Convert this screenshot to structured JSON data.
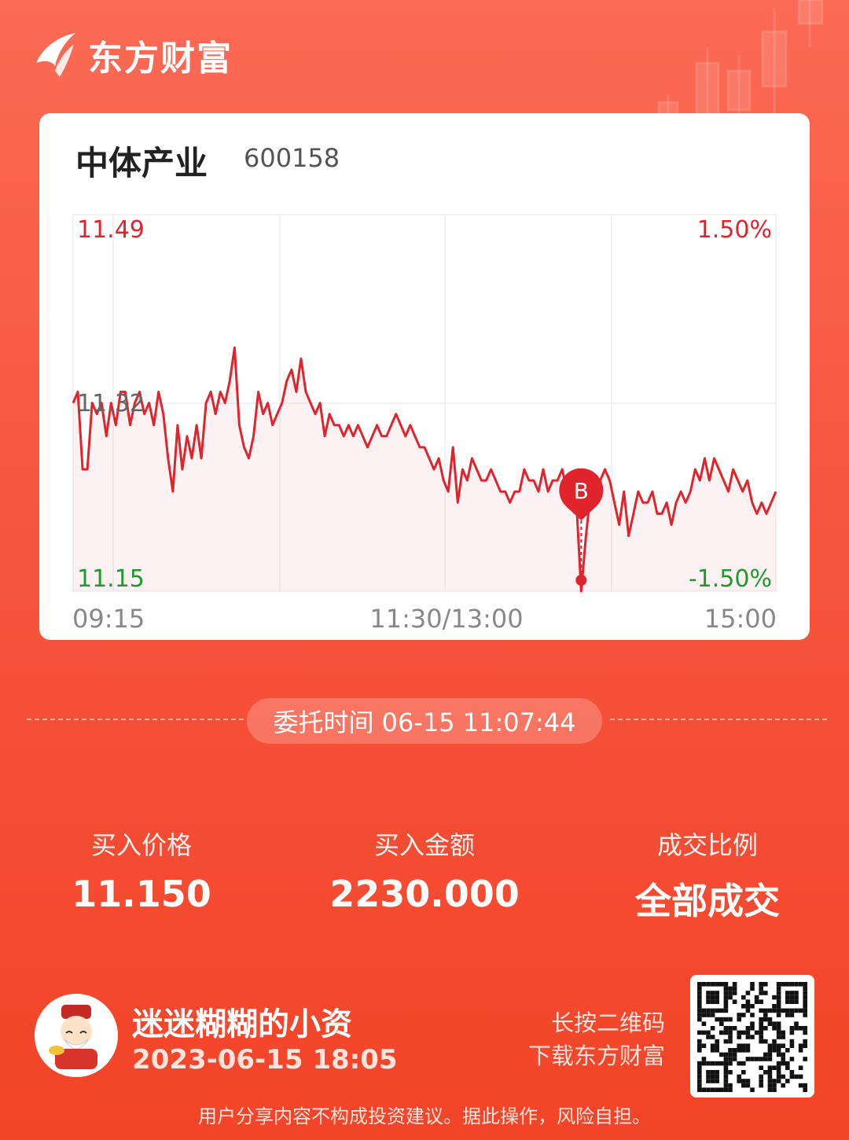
{
  "brand": {
    "name": "东方财富",
    "icon": "eastmoney-logo-icon"
  },
  "stock": {
    "name": "中体产业",
    "code": "600158"
  },
  "chart_data": {
    "type": "line",
    "y_left": {
      "max": "11.49",
      "mid": "11.32",
      "min": "11.15"
    },
    "y_right": {
      "max": "1.50%",
      "min": "-1.50%"
    },
    "ylim": [
      11.15,
      11.49
    ],
    "x_ticks": [
      "09:15",
      "11:30/13:00",
      "15:00"
    ],
    "marker": {
      "label": "B",
      "price": 11.15
    },
    "series": [
      {
        "values": [
          11.32,
          11.33,
          11.26,
          11.26,
          11.32,
          11.31,
          11.32,
          11.29,
          11.32,
          11.3,
          11.33,
          11.33,
          11.3,
          11.32,
          11.33,
          11.31,
          11.32,
          11.3,
          11.33,
          11.31,
          11.27,
          11.24,
          11.3,
          11.26,
          11.29,
          11.27,
          11.3,
          11.27,
          11.32,
          11.33,
          11.31,
          11.33,
          11.32,
          11.34,
          11.37,
          11.3,
          11.28,
          11.27,
          11.29,
          11.33,
          11.31,
          11.32,
          11.3,
          11.31,
          11.32,
          11.34,
          11.35,
          11.33,
          11.36,
          11.33,
          11.32,
          11.31,
          11.32,
          11.29,
          11.31,
          11.3,
          11.3,
          11.29,
          11.3,
          11.29,
          11.3,
          11.29,
          11.28,
          11.29,
          11.3,
          11.29,
          11.29,
          11.3,
          11.31,
          11.3,
          11.29,
          11.3,
          11.29,
          11.28,
          11.28,
          11.27,
          11.26,
          11.27,
          11.25,
          11.24,
          11.28,
          11.23,
          11.26,
          11.25,
          11.27,
          11.26,
          11.25,
          11.25,
          11.26,
          11.25,
          11.24,
          11.24,
          11.23,
          11.24,
          11.24,
          11.26,
          11.25,
          11.25,
          11.24,
          11.26,
          11.24,
          11.25,
          11.25,
          11.26,
          11.24,
          11.25,
          11.23,
          11.15,
          11.2,
          11.24,
          11.23,
          11.25,
          11.26,
          11.25,
          11.23,
          11.21,
          11.24,
          11.2,
          11.22,
          11.24,
          11.23,
          11.23,
          11.24,
          11.22,
          11.22,
          11.23,
          11.21,
          11.23,
          11.24,
          11.23,
          11.24,
          11.26,
          11.25,
          11.27,
          11.25,
          11.27,
          11.26,
          11.25,
          11.24,
          11.26,
          11.25,
          11.24,
          11.25,
          11.23,
          11.22,
          11.23,
          11.22,
          11.23,
          11.24
        ]
      }
    ]
  },
  "order_time": "委托时间 06-15 11:07:44",
  "stats": [
    {
      "label": "买入价格",
      "value": "11.150"
    },
    {
      "label": "买入金额",
      "value": "2230.000"
    },
    {
      "label": "成交比例",
      "value": "全部成交"
    }
  ],
  "user": {
    "name": "迷迷糊糊的小资",
    "time": "2023-06-15 18:05",
    "avatar": "fortune-god-avatar-icon"
  },
  "qr": {
    "hint_line1": "长按二维码",
    "hint_line2": "下载东方财富",
    "icon": "qr-code-icon"
  },
  "disclaimer": "用户分享内容不构成投资建议。据此操作，风险自担。",
  "colors": {
    "up": "#e0242b",
    "down": "#1f9a2f",
    "neutral": "#666666",
    "background": "#f7553f"
  }
}
